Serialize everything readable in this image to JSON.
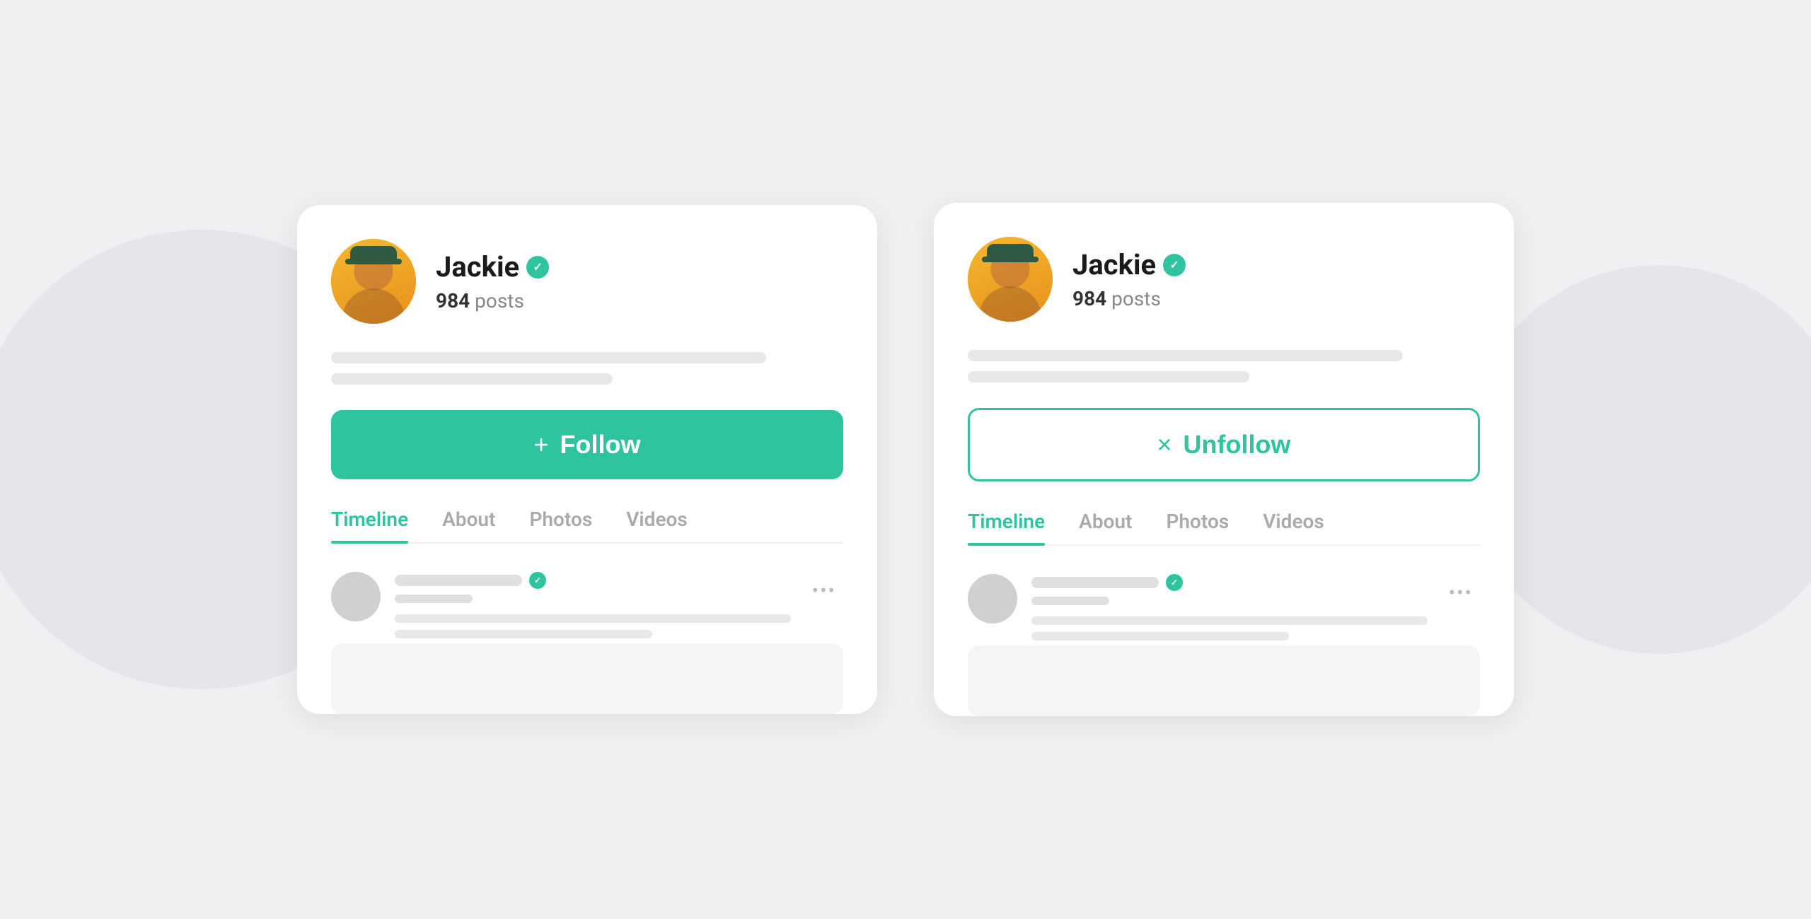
{
  "page": {
    "background_color": "#f0f0f2"
  },
  "left_card": {
    "profile": {
      "name": "Jackie",
      "verified": true,
      "posts_count": "984",
      "posts_label": "posts"
    },
    "follow_button": {
      "label": "Follow",
      "icon": "+",
      "type": "filled"
    },
    "tabs": [
      {
        "label": "Timeline",
        "active": true
      },
      {
        "label": "About",
        "active": false
      },
      {
        "label": "Photos",
        "active": false
      },
      {
        "label": "Videos",
        "active": false
      }
    ],
    "post": {
      "more_icon": "•••"
    }
  },
  "right_card": {
    "profile": {
      "name": "Jackie",
      "verified": true,
      "posts_count": "984",
      "posts_label": "posts"
    },
    "unfollow_button": {
      "label": "Unfollow",
      "icon": "×",
      "type": "outline"
    },
    "tabs": [
      {
        "label": "Timeline",
        "active": true
      },
      {
        "label": "About",
        "active": false
      },
      {
        "label": "Photos",
        "active": false
      },
      {
        "label": "Videos",
        "active": false
      }
    ],
    "post": {
      "more_icon": "•••"
    }
  },
  "colors": {
    "accent": "#2ec4a0",
    "text_dark": "#1a1a1a",
    "text_muted": "#888888",
    "skeleton": "#e8e8e8",
    "bg": "#f0f0f2"
  }
}
